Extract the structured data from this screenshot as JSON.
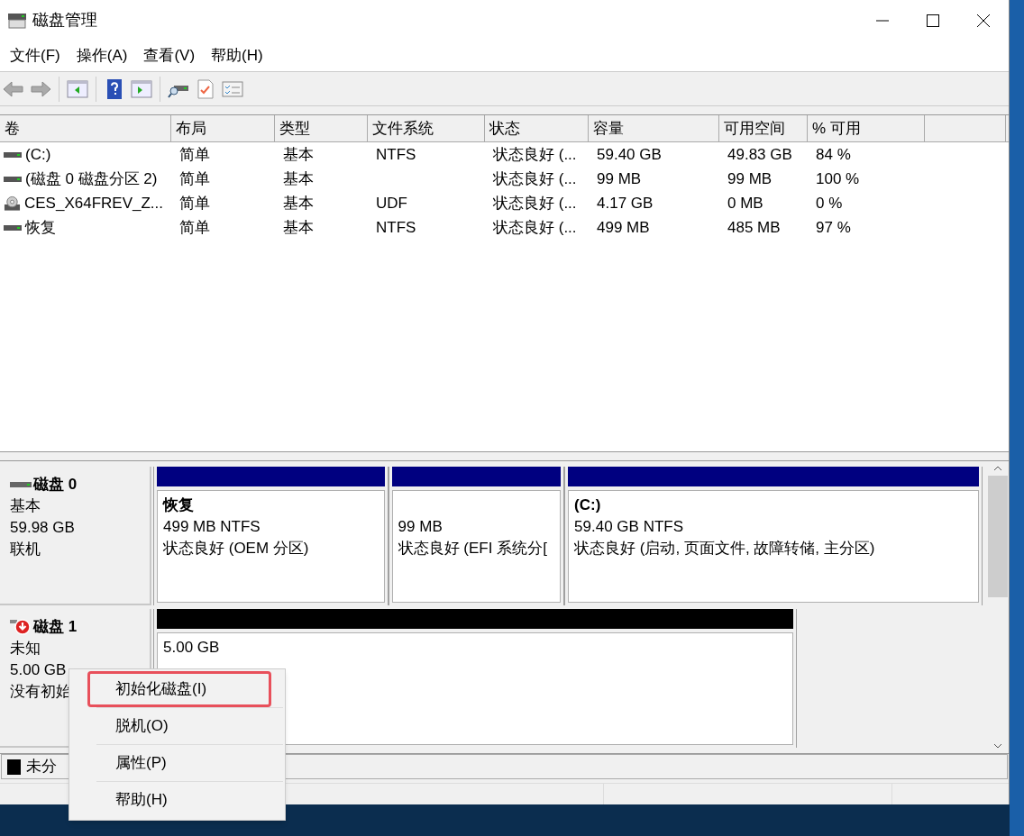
{
  "window": {
    "title": "磁盘管理"
  },
  "menu": [
    "文件(F)",
    "操作(A)",
    "查看(V)",
    "帮助(H)"
  ],
  "table": {
    "columns": [
      "卷",
      "布局",
      "类型",
      "文件系统",
      "状态",
      "容量",
      "可用空间",
      "% 可用"
    ],
    "rows": [
      {
        "kind": "drive",
        "cells": [
          " (C:)",
          "简单",
          "基本",
          "NTFS",
          "状态良好 (...",
          "59.40 GB",
          "49.83 GB",
          "84 %"
        ]
      },
      {
        "kind": "drive",
        "cells": [
          "(磁盘 0 磁盘分区 2)",
          "简单",
          "基本",
          "",
          "状态良好 (...",
          "99 MB",
          "99 MB",
          "100 %"
        ]
      },
      {
        "kind": "disc",
        "cells": [
          "CES_X64FREV_Z...",
          "简单",
          "基本",
          "UDF",
          "状态良好 (...",
          "4.17 GB",
          "0 MB",
          "0 %"
        ]
      },
      {
        "kind": "drive",
        "cells": [
          "恢复",
          "简单",
          "基本",
          "NTFS",
          "状态良好 (...",
          "499 MB",
          "485 MB",
          "97 %"
        ]
      }
    ]
  },
  "disks": [
    {
      "name": "磁盘 0",
      "kind": "basic",
      "lines": [
        "基本",
        "59.98 GB",
        "联机"
      ],
      "partitions": [
        {
          "kind": "primary",
          "label": "恢复",
          "size": "499 MB NTFS",
          "status": "状态良好 (OEM 分区)"
        },
        {
          "kind": "primary",
          "size": "99 MB",
          "status": "状态良好 (EFI 系统分["
        },
        {
          "kind": "primary",
          "label": "(C:)",
          "size": "59.40 GB NTFS",
          "status": "状态良好 (启动, 页面文件, 故障转储, 主分区)"
        }
      ]
    },
    {
      "name": "磁盘 1",
      "kind": "unknown",
      "lines": [
        "未知",
        "5.00 GB",
        "没有初始"
      ],
      "partitions": [
        {
          "kind": "unallocated",
          "size": "5.00 GB"
        }
      ]
    }
  ],
  "legend": [
    {
      "label": "未分",
      "color": "#000000"
    }
  ],
  "context_menu": [
    {
      "label": "初始化磁盘(I)",
      "selected": true
    },
    {
      "label": "脱机(O)",
      "selected": false
    },
    {
      "label": "属性(P)",
      "selected": false
    },
    {
      "label": "帮助(H)",
      "selected": false
    }
  ]
}
